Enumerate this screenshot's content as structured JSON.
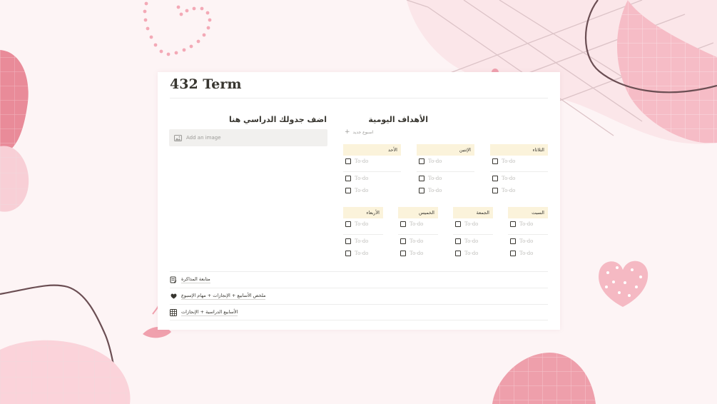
{
  "page": {
    "title": "432 Term"
  },
  "schedule": {
    "heading": "اضف جدولك الدراسي هنا",
    "add_image_label": "Add an image"
  },
  "goals": {
    "heading": "الأهداف اليومية",
    "new_week_label": "اسبوع جديد",
    "todo_placeholder": "To-do",
    "days_row1": [
      {
        "label": "الأحد"
      },
      {
        "label": "الإثنين"
      },
      {
        "label": "الثلاثاء"
      }
    ],
    "days_row2": [
      {
        "label": "الأربعاء"
      },
      {
        "label": "الخميس"
      },
      {
        "label": "الجمعة"
      },
      {
        "label": "السبت"
      }
    ]
  },
  "links": [
    {
      "label": "متابعة المذاكرة",
      "icon": "notepad-icon"
    },
    {
      "label": "ملخص الأسابيع + الإنجازات + مهام الإسبوع",
      "icon": "heart-icon"
    },
    {
      "label": "الأسابيع الدراسية + الإنجازات",
      "icon": "calendar-grid-icon"
    }
  ],
  "colors": {
    "background": "#fdf4f5",
    "blob_pink": "#f6c3cc",
    "blob_deep": "#e88a98",
    "day_header": "#fbf3db",
    "line_brown": "#6b4e53"
  }
}
